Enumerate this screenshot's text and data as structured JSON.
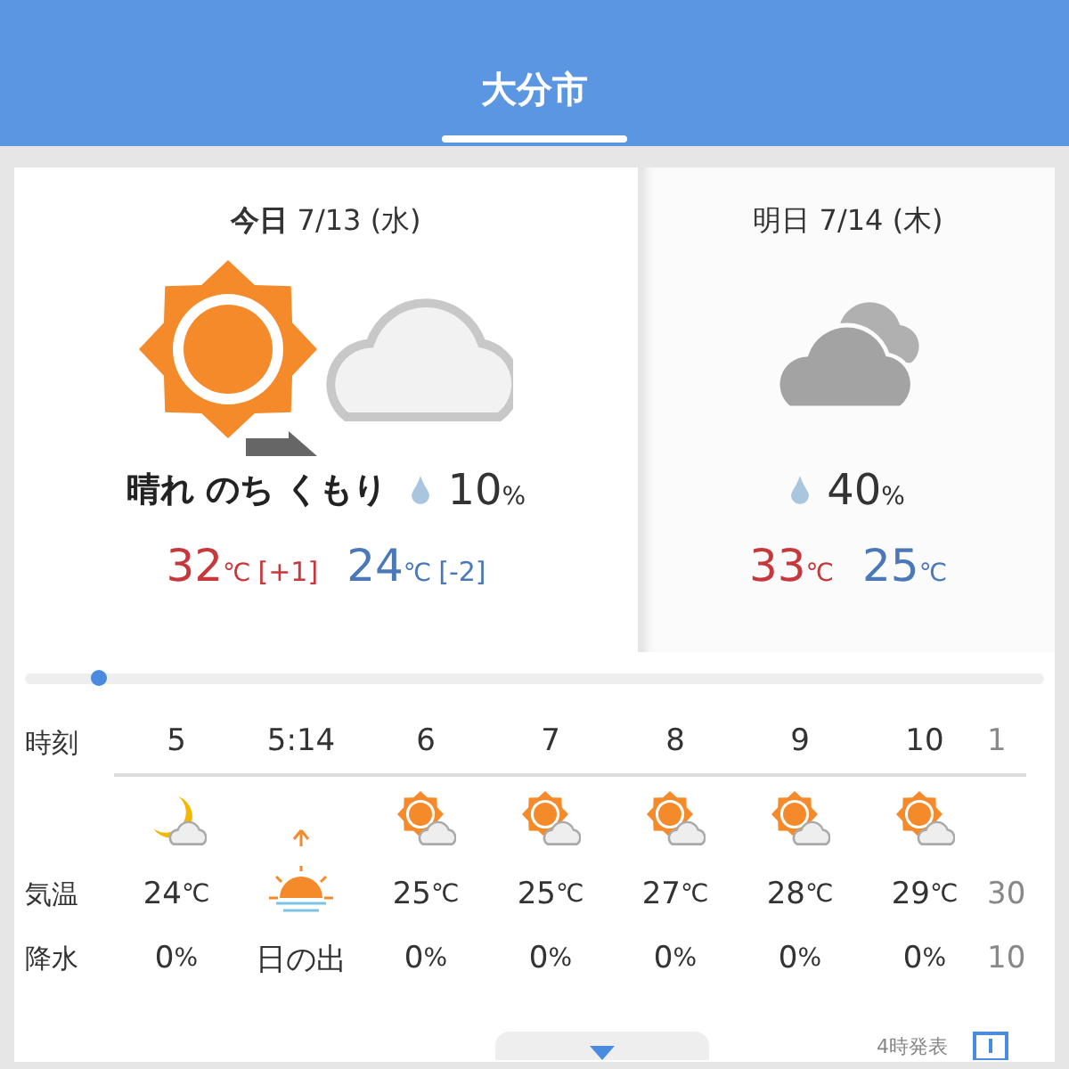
{
  "header": {
    "title": "大分市"
  },
  "days": [
    {
      "label": "今日",
      "date": "7/13",
      "weekday": "(水)",
      "selected": true,
      "kind": "sun_then_cloud",
      "weather": "晴れ のち くもり",
      "rain": "10",
      "rain_unit": "%",
      "high": "32",
      "low": "24",
      "unit": "℃",
      "high_diff": "[+1]",
      "low_diff": "[-2]"
    },
    {
      "label": "明日",
      "date": "7/14",
      "weekday": "(木)",
      "selected": false,
      "kind": "cloudy",
      "rain": "40",
      "rain_unit": "%",
      "high": "33",
      "low": "25",
      "unit": "℃"
    }
  ],
  "hourly": {
    "row_labels": [
      "時刻",
      "気温",
      "降水"
    ],
    "columns": [
      {
        "kind": "moon_cloud",
        "time": "5",
        "temp": "24",
        "unit": "℃",
        "rain": "0",
        "rain_unit": "%"
      },
      {
        "kind": "sunrise",
        "time": "5:14",
        "caption": "日の出"
      },
      {
        "kind": "sun_cloud",
        "time": "6",
        "temp": "25",
        "unit": "℃",
        "rain": "0",
        "rain_unit": "%"
      },
      {
        "kind": "sun_cloud",
        "time": "7",
        "temp": "25",
        "unit": "℃",
        "rain": "0",
        "rain_unit": "%"
      },
      {
        "kind": "sun_cloud",
        "time": "8",
        "temp": "27",
        "unit": "℃",
        "rain": "0",
        "rain_unit": "%"
      },
      {
        "kind": "sun_cloud",
        "time": "9",
        "temp": "28",
        "unit": "℃",
        "rain": "0",
        "rain_unit": "%"
      },
      {
        "kind": "sun_cloud",
        "time": "10",
        "temp": "29",
        "unit": "℃",
        "rain": "0",
        "rain_unit": "%"
      },
      {
        "kind": "cut_off",
        "time": "1",
        "temp": "30",
        "rain": "10"
      }
    ]
  },
  "footer": {
    "issued": "4時発表"
  }
}
